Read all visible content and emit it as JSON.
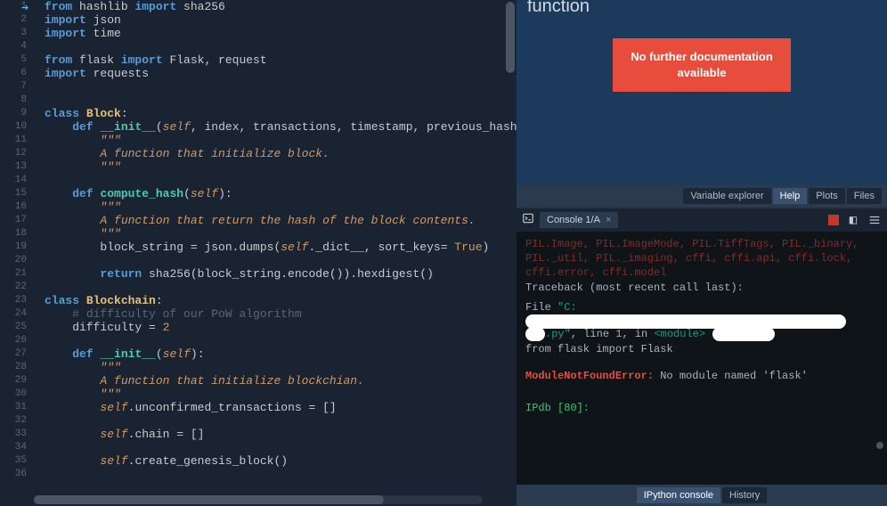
{
  "editor": {
    "lines": [
      {
        "n": 1,
        "seg": [
          {
            "c": "kw",
            "t": "from"
          },
          {
            "c": "txt",
            "t": " hashlib "
          },
          {
            "c": "kw",
            "t": "import"
          },
          {
            "c": "txt",
            "t": " sha256"
          }
        ]
      },
      {
        "n": 2,
        "seg": [
          {
            "c": "kw",
            "t": "import"
          },
          {
            "c": "txt",
            "t": " json"
          }
        ]
      },
      {
        "n": 3,
        "seg": [
          {
            "c": "kw",
            "t": "import"
          },
          {
            "c": "txt",
            "t": " time"
          }
        ]
      },
      {
        "n": 4,
        "seg": []
      },
      {
        "n": 5,
        "seg": [
          {
            "c": "kw",
            "t": "from"
          },
          {
            "c": "txt",
            "t": " flask "
          },
          {
            "c": "kw",
            "t": "import"
          },
          {
            "c": "txt",
            "t": " Flask, request"
          }
        ]
      },
      {
        "n": 6,
        "seg": [
          {
            "c": "kw",
            "t": "import"
          },
          {
            "c": "txt",
            "t": " requests"
          }
        ]
      },
      {
        "n": 7,
        "seg": []
      },
      {
        "n": 8,
        "seg": []
      },
      {
        "n": 9,
        "seg": [
          {
            "c": "kw",
            "t": "class"
          },
          {
            "c": "txt",
            "t": " "
          },
          {
            "c": "cls",
            "t": "Block"
          },
          {
            "c": "txt",
            "t": ":"
          }
        ]
      },
      {
        "n": 10,
        "seg": [
          {
            "c": "txt",
            "t": "    "
          },
          {
            "c": "kw",
            "t": "def"
          },
          {
            "c": "txt",
            "t": " "
          },
          {
            "c": "fn",
            "t": "__init__"
          },
          {
            "c": "txt",
            "t": "("
          },
          {
            "c": "self",
            "t": "self"
          },
          {
            "c": "txt",
            "t": ", index, transactions, timestamp, previous_hash,"
          }
        ]
      },
      {
        "n": 11,
        "seg": [
          {
            "c": "txt",
            "t": "        "
          },
          {
            "c": "str",
            "t": "\"\"\""
          }
        ]
      },
      {
        "n": 12,
        "seg": [
          {
            "c": "txt",
            "t": "        "
          },
          {
            "c": "str",
            "t": "A function that initialize block."
          }
        ]
      },
      {
        "n": 13,
        "seg": [
          {
            "c": "txt",
            "t": "        "
          },
          {
            "c": "str",
            "t": "\"\"\""
          }
        ]
      },
      {
        "n": 14,
        "seg": []
      },
      {
        "n": 15,
        "seg": [
          {
            "c": "txt",
            "t": "    "
          },
          {
            "c": "kw",
            "t": "def"
          },
          {
            "c": "txt",
            "t": " "
          },
          {
            "c": "fn",
            "t": "compute_hash"
          },
          {
            "c": "txt",
            "t": "("
          },
          {
            "c": "self",
            "t": "self"
          },
          {
            "c": "txt",
            "t": "):"
          }
        ]
      },
      {
        "n": 16,
        "seg": [
          {
            "c": "txt",
            "t": "        "
          },
          {
            "c": "str",
            "t": "\"\"\""
          }
        ]
      },
      {
        "n": 17,
        "seg": [
          {
            "c": "txt",
            "t": "        "
          },
          {
            "c": "str",
            "t": "A function that return the hash of the block contents."
          }
        ]
      },
      {
        "n": 18,
        "seg": [
          {
            "c": "txt",
            "t": "        "
          },
          {
            "c": "str",
            "t": "\"\"\""
          }
        ]
      },
      {
        "n": 19,
        "seg": [
          {
            "c": "txt",
            "t": "        block_string = json.dumps("
          },
          {
            "c": "self",
            "t": "self"
          },
          {
            "c": "txt",
            "t": "._dict__, sort_keys= "
          },
          {
            "c": "lit",
            "t": "True"
          },
          {
            "c": "txt",
            "t": ")"
          }
        ]
      },
      {
        "n": 20,
        "seg": []
      },
      {
        "n": 21,
        "seg": [
          {
            "c": "txt",
            "t": "        "
          },
          {
            "c": "kw",
            "t": "return"
          },
          {
            "c": "txt",
            "t": " sha256(block_string.encode()).hexdigest()"
          }
        ]
      },
      {
        "n": 22,
        "seg": []
      },
      {
        "n": 23,
        "seg": [
          {
            "c": "kw",
            "t": "class"
          },
          {
            "c": "txt",
            "t": " "
          },
          {
            "c": "cls",
            "t": "Blockchain"
          },
          {
            "c": "txt",
            "t": ":"
          }
        ]
      },
      {
        "n": 24,
        "seg": [
          {
            "c": "txt",
            "t": "    "
          },
          {
            "c": "cmt",
            "t": "# difficulty of our PoW algorithm"
          }
        ]
      },
      {
        "n": 25,
        "seg": [
          {
            "c": "txt",
            "t": "    difficulty = "
          },
          {
            "c": "lit",
            "t": "2"
          }
        ]
      },
      {
        "n": 26,
        "seg": []
      },
      {
        "n": 27,
        "seg": [
          {
            "c": "txt",
            "t": "    "
          },
          {
            "c": "kw",
            "t": "def"
          },
          {
            "c": "txt",
            "t": " "
          },
          {
            "c": "fn",
            "t": "__init__"
          },
          {
            "c": "txt",
            "t": "("
          },
          {
            "c": "self",
            "t": "self"
          },
          {
            "c": "txt",
            "t": "):"
          }
        ]
      },
      {
        "n": 28,
        "seg": [
          {
            "c": "txt",
            "t": "        "
          },
          {
            "c": "str",
            "t": "\"\"\""
          }
        ]
      },
      {
        "n": 29,
        "seg": [
          {
            "c": "txt",
            "t": "        "
          },
          {
            "c": "str",
            "t": "A function that initialize blockchian."
          }
        ]
      },
      {
        "n": 30,
        "seg": [
          {
            "c": "txt",
            "t": "        "
          },
          {
            "c": "str",
            "t": "\"\"\""
          }
        ]
      },
      {
        "n": 31,
        "seg": [
          {
            "c": "txt",
            "t": "        "
          },
          {
            "c": "self",
            "t": "self"
          },
          {
            "c": "txt",
            "t": ".unconfirmed_transactions = []"
          }
        ]
      },
      {
        "n": 32,
        "seg": []
      },
      {
        "n": 33,
        "seg": [
          {
            "c": "txt",
            "t": "        "
          },
          {
            "c": "self",
            "t": "self"
          },
          {
            "c": "txt",
            "t": ".chain = []"
          }
        ]
      },
      {
        "n": 34,
        "seg": []
      },
      {
        "n": 35,
        "seg": [
          {
            "c": "txt",
            "t": "        "
          },
          {
            "c": "self",
            "t": "self"
          },
          {
            "c": "txt",
            "t": ".create_genesis_block()"
          }
        ]
      },
      {
        "n": 36,
        "seg": []
      }
    ]
  },
  "doc": {
    "title": "function",
    "alert_line1": "No further documentation",
    "alert_line2": "available",
    "tabs": [
      "Variable explorer",
      "Help",
      "Plots",
      "Files"
    ],
    "active_tab": "Help"
  },
  "console": {
    "tab_label": "Console 1/A",
    "body": {
      "mods_line": "PIL.Image, PIL.ImageMode, PIL.TiffTags, PIL._binary, PIL._util, PIL._imaging, cffi, cffi.api, cffi.lock, cffi.error, cffi.model",
      "traceback": "Traceback (most recent call last):",
      "file_prefix": "  File ",
      "file_q": "\"C:",
      "py_tail": ".py\"",
      "line_part": ", line ",
      "line_no": "1",
      "in_part": ", in ",
      "module": "<module>",
      "import_line": "    from flask import Flask",
      "err_name": "ModuleNotFoundError:",
      "err_msg": " No module named 'flask'",
      "prompt": "IPdb [80]:"
    },
    "bottom_tabs": [
      "IPython console",
      "History"
    ],
    "active_bottom": "IPython console"
  }
}
